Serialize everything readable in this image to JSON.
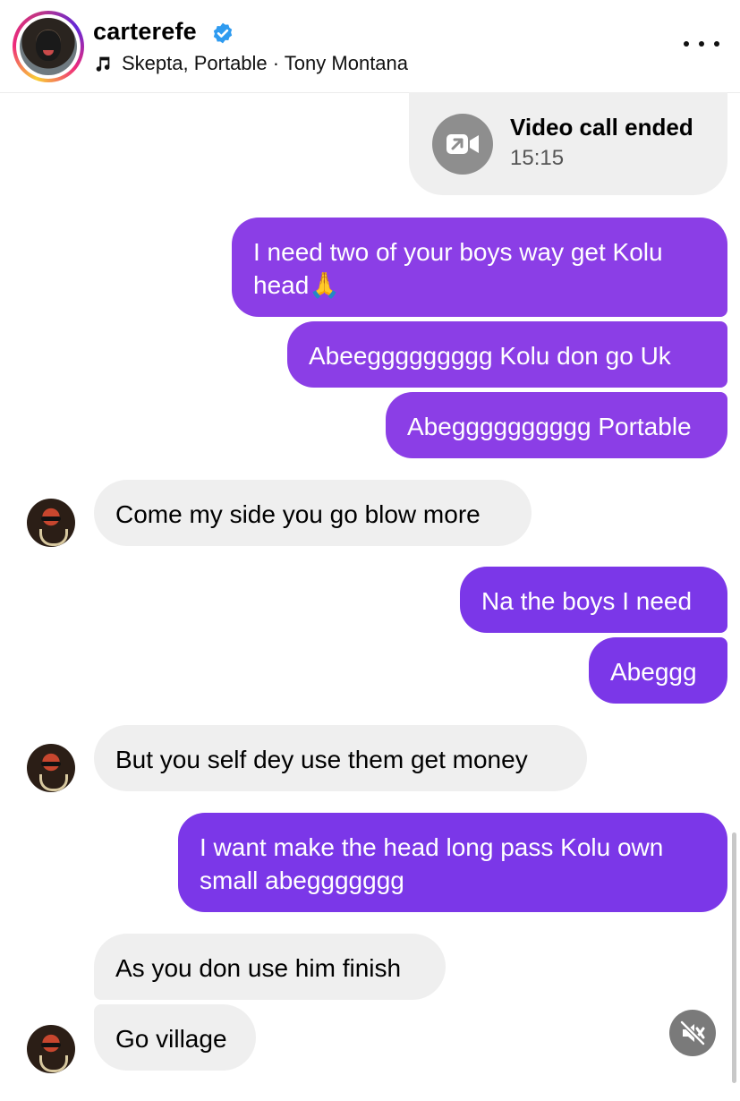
{
  "header": {
    "username": "carterefe",
    "verified": true,
    "music": "Skepta, Portable · Tony Montana",
    "icons": {
      "music": "music-note-icon",
      "verified": "verified-badge-icon",
      "more": "more-options-icon"
    }
  },
  "call": {
    "title": "Video call ended",
    "time": "15:15",
    "icon": "video-call-icon"
  },
  "messages": [
    {
      "from": "me",
      "text": "I need two of your boys way get Kolu\nhead🙏"
    },
    {
      "from": "me",
      "text": "Abeeggggggggg Kolu don go Uk"
    },
    {
      "from": "me",
      "text": "Abegggggggggg Portable"
    },
    {
      "from": "them",
      "text": "Come my side you go blow more"
    },
    {
      "from": "me",
      "text": "Na the boys I need"
    },
    {
      "from": "me",
      "text": "Abeggg"
    },
    {
      "from": "them",
      "text": "But you self dey use them get money"
    },
    {
      "from": "me",
      "text": "I want make the head long pass Kolu own\nsmall abeggggggg"
    },
    {
      "from": "them",
      "text": "As you don use him finish"
    },
    {
      "from": "them",
      "text": "Go village"
    }
  ],
  "controls": {
    "mute_icon": "muted-speaker-icon"
  },
  "colors": {
    "outgoing": "#8b3ee6",
    "incoming": "#efefef",
    "verified": "#2f9bf0"
  }
}
